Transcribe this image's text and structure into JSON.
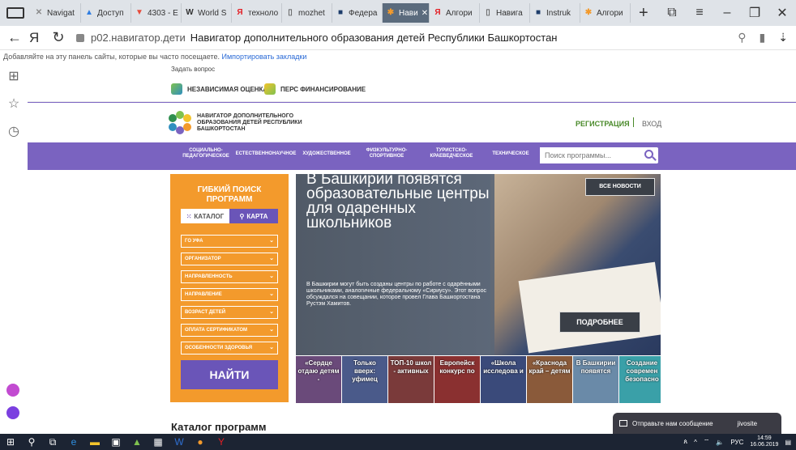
{
  "browser": {
    "tabs": [
      {
        "label": "Navigat",
        "color": "#8a8a8a",
        "glyph": "✕"
      },
      {
        "label": "Доступ",
        "color": "#2f7de1",
        "glyph": "▲"
      },
      {
        "label": "4303 - E",
        "color": "#e74c3c",
        "glyph": "▼"
      },
      {
        "label": "World S",
        "color": "#333333",
        "glyph": "W"
      },
      {
        "label": "техноло",
        "color": "#e31e24",
        "glyph": "Я"
      },
      {
        "label": "mozhet",
        "color": "#666666",
        "glyph": "▯"
      },
      {
        "label": "Федера",
        "color": "#1e3d6b",
        "glyph": "■"
      },
      {
        "label": "Нави",
        "color": "#f39a2c",
        "glyph": "✱",
        "active": true
      },
      {
        "label": "Алгори",
        "color": "#e31e24",
        "glyph": "Я"
      },
      {
        "label": "Навига",
        "color": "#666666",
        "glyph": "▯"
      },
      {
        "label": "Instruk",
        "color": "#1e3d6b",
        "glyph": "■"
      },
      {
        "label": "Алгори",
        "color": "#f39a2c",
        "glyph": "✱"
      }
    ],
    "new_tab": "+",
    "address_host": "p02.навигатор.дети",
    "page_title": "Навигатор дополнительного образования детей Республики Башкортостан",
    "ya_glyph": "Я",
    "bookmarks_text": "Добавляйте на эту панель сайты, которые вы часто посещаете.",
    "bookmarks_link": "Импортировать закладки"
  },
  "site": {
    "ask_link": "Задать вопрос",
    "top_links": [
      "НЕЗАВИСИМАЯ ОЦЕНКА",
      "ПЕРС ФИНАНСИРОВАНИЕ"
    ],
    "logo_text": "НАВИГАТОР ДОПОЛНИТЕЛЬНОГО\nОБРАЗОВАНИЯ ДЕТЕЙ РЕСПУБЛИКИ\nБАШКОРТОСТАН",
    "register": "РЕГИСТРАЦИЯ",
    "login": "ВХОД",
    "menu": [
      "СОЦИАЛЬНО-\nПЕДАГОГИЧЕСКОЕ",
      "ЕСТЕСТВЕННОНАУЧНОЕ",
      "ХУДОЖЕСТВЕННОЕ",
      "ФИЗКУЛЬТУРНО-\nСПОРТИВНОЕ",
      "ТУРИСТСКО-\nКРАЕВЕДЧЕСКОЕ",
      "ТЕХНИЧЕСКОЕ"
    ],
    "search_placeholder": "Поиск программы...",
    "filter": {
      "title": "ГИБКИЙ ПОИСК\nПРОГРАММ",
      "tab_catalog": "КАТАЛОГ",
      "tab_map": "КАРТА",
      "selects": [
        "ГО УФА",
        "ОРГАНИЗАТОР",
        "НАПРАВЛЕННОСТЬ",
        "НАПРАВЛЕНИЕ",
        "ВОЗРАСТ ДЕТЕЙ",
        "ОПЛАТА СЕРТИФИКАТОМ",
        "ОСОБЕННОСТИ ЗДОРОВЬЯ"
      ],
      "find_button": "НАЙТИ"
    },
    "news": {
      "headline": "В Башкирии появятся образовательные центры для одаренных школьников",
      "body": "В Башкирии могут быть созданы центры по работе с одарёнными школьниками, аналогичные федеральному «Сириусу». Этот вопрос обсуждался на совещании, которое провел Глава Башкортостана Рустэм Хамитов.",
      "all_news": "ВСЕ НОВОСТИ",
      "more": "ПОДРОБНЕЕ",
      "thumbs": [
        {
          "text": "«Сердце отдаю детям -",
          "color": "#6a4a7a"
        },
        {
          "text": "Только вверх: уфимец",
          "color": "#4a5a8a"
        },
        {
          "text": "ТОП-10 школ - активных",
          "color": "#7a3a3a"
        },
        {
          "text": "Европейск конкурс по",
          "color": "#8a3030"
        },
        {
          "text": "«Школа исследова и",
          "color": "#3a4a7a"
        },
        {
          "text": "«Краснода край – детям",
          "color": "#8a5a3a"
        },
        {
          "text": "В Башкирии появятся",
          "color": "#6a8aa8"
        },
        {
          "text": "Создание современ безопасно",
          "color": "#3aa0a8"
        }
      ]
    },
    "catalog_heading": "Каталог программ",
    "chat": {
      "label": "Отправьте нам сообщение",
      "brand": "jivosite"
    }
  },
  "taskbar": {
    "lang": "РУС",
    "time": "14:59",
    "date": "16.06.2019"
  }
}
